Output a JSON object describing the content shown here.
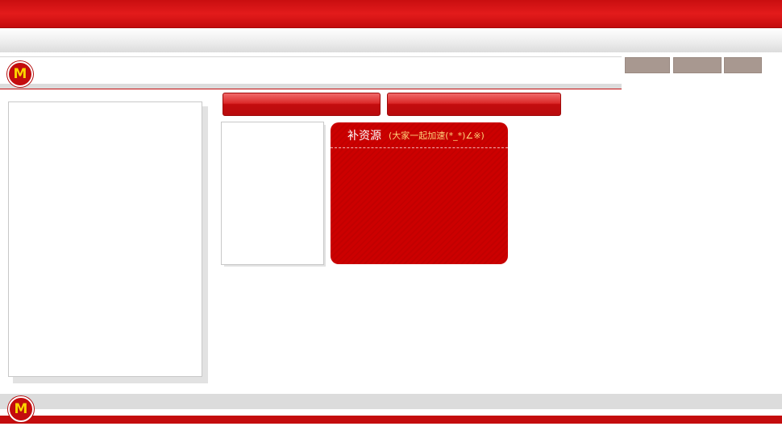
{
  "brand": {
    "logo_letter": "M",
    "primary_color": "#c40c0e",
    "accent_yellow": "#ffd200"
  },
  "card": {
    "title": "补资源",
    "subtitle": "(大家一起加速(*_*)∠※)"
  },
  "icons": {
    "logo": "m-logo-icon"
  }
}
